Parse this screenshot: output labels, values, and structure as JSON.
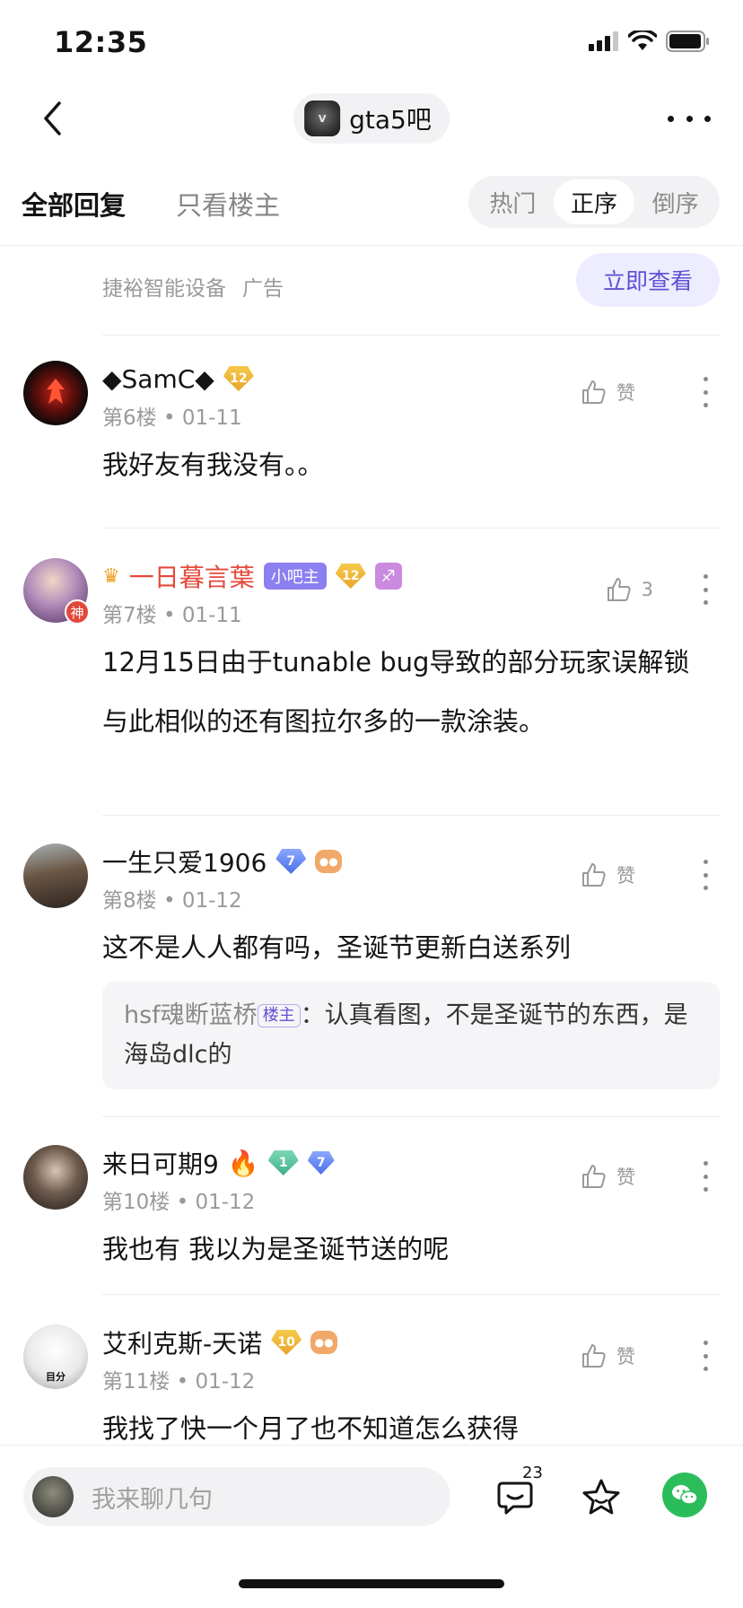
{
  "status_bar": {
    "time": "12:35"
  },
  "nav": {
    "forum_name": "gta5吧"
  },
  "filter": {
    "tab_all": "全部回复",
    "tab_owner": "只看楼主",
    "sort_hot": "热门",
    "sort_asc": "正序",
    "sort_desc": "倒序",
    "active_sort": "正序"
  },
  "ad": {
    "advertiser": "捷裕智能设备",
    "ad_label": "广告",
    "cta": "立即查看"
  },
  "posts": [
    {
      "author": "◆SamC◆",
      "level": "12",
      "floor": "第6楼",
      "date": "01-11",
      "like": "赞",
      "content": [
        "我好友有我没有。。"
      ]
    },
    {
      "author": "一日暮言葉",
      "role": "小吧主",
      "level": "12",
      "avatar_badge": "神",
      "floor": "第7楼",
      "date": "01-11",
      "like": "3",
      "content": [
        "12月15日由于tunable bug导致的部分玩家误解锁",
        "与此相似的还有图拉尔多的一款涂装。"
      ]
    },
    {
      "author": "一生只爱1906",
      "level": "7",
      "floor": "第8楼",
      "date": "01-12",
      "like": "赞",
      "content": [
        "这不是人人都有吗，圣诞节更新白送系列"
      ],
      "quote": {
        "author": "hsf魂断蓝桥",
        "tag": "楼主",
        "text": "：认真看图，不是圣诞节的东西，是海岛dlc的"
      }
    },
    {
      "author": "来日可期9",
      "level": "1",
      "level2": "7",
      "floor": "第10楼",
      "date": "01-12",
      "like": "赞",
      "content": [
        "我也有 我以为是圣诞节送的呢"
      ]
    },
    {
      "author": "艾利克斯-天诺",
      "level": "10",
      "avatar_text": "目分",
      "floor": "第11楼",
      "date": "01-12",
      "like": "赞",
      "content": [
        "我找了快一个月了也不知道怎么获得"
      ]
    }
  ],
  "bottom": {
    "placeholder": "我来聊几句",
    "comment_count": "23"
  },
  "colors": {
    "accent": "#614fd3",
    "admin_red": "#e34a3c",
    "wechat": "#2bbd5a"
  }
}
